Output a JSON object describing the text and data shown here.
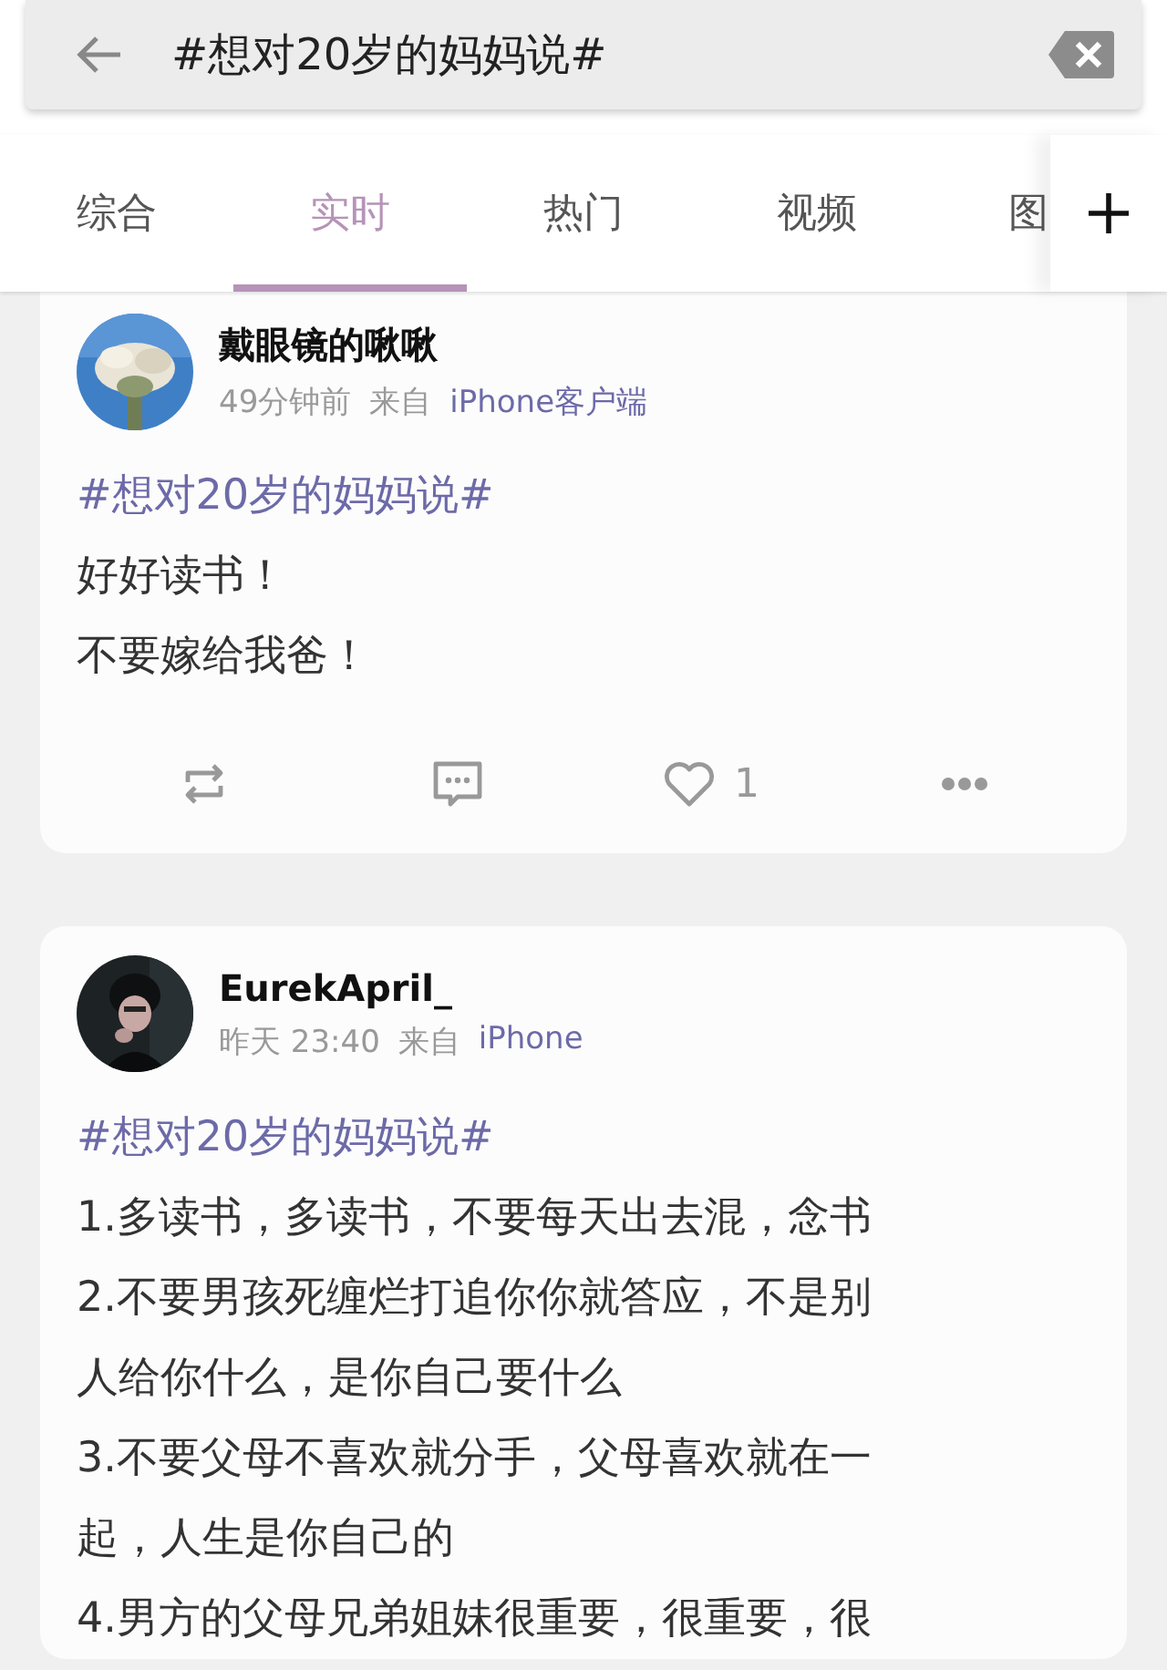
{
  "search": {
    "value": "#想对20岁的妈妈说#"
  },
  "tabs": [
    {
      "label": "综合",
      "selected": false
    },
    {
      "label": "实时",
      "selected": true
    },
    {
      "label": "热门",
      "selected": false
    },
    {
      "label": "视频",
      "selected": false
    },
    {
      "label": "图",
      "selected": false
    }
  ],
  "posts": [
    {
      "name": "戴眼镜的啾啾",
      "time": "49分钟前",
      "from": "来自",
      "source": "iPhone客户端",
      "lines": [
        {
          "kind": "topic",
          "text": "#想对20岁的妈妈说#"
        },
        {
          "kind": "text",
          "text": "好好读书！"
        },
        {
          "kind": "text",
          "text": "不要嫁给我爸！"
        }
      ],
      "actions": [
        {
          "kind": "repost"
        },
        {
          "kind": "comment"
        },
        {
          "kind": "like",
          "count": "1"
        },
        {
          "kind": "more"
        }
      ]
    },
    {
      "name": "EurekApril_",
      "time": "昨天 23:40",
      "from": "来自",
      "source": "iPhone",
      "lines": [
        {
          "kind": "topic",
          "text": "#想对20岁的妈妈说#"
        },
        {
          "kind": "text",
          "text": "1.多读书，多读书，不要每天出去混，念书"
        },
        {
          "kind": "text",
          "text": "2.不要男孩死缠烂打追你你就答应，不是别"
        },
        {
          "kind": "text",
          "text": "人给你什么，是你自己要什么"
        },
        {
          "kind": "text",
          "text": "3.不要父母不喜欢就分手，父母喜欢就在一"
        },
        {
          "kind": "text",
          "text": "起，人生是你自己的"
        },
        {
          "kind": "text",
          "text": "4.男方的父母兄弟姐妹很重要，很重要，很"
        }
      ]
    }
  ]
}
